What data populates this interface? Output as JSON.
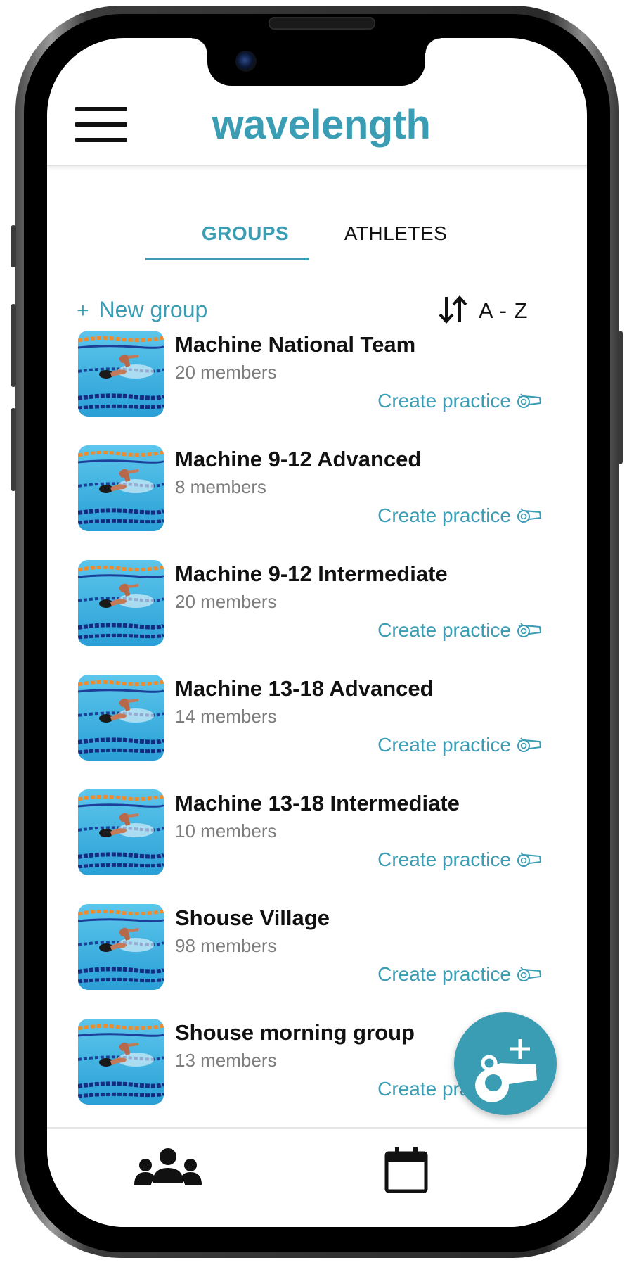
{
  "header": {
    "app_title": "wavelength",
    "menu_icon": "hamburger-menu-icon"
  },
  "tabs": [
    {
      "label": "GROUPS",
      "active": true
    },
    {
      "label": "ATHLETES",
      "active": false
    }
  ],
  "actions": {
    "new_group_plus": "+",
    "new_group_label": "New group",
    "sort_icon": "sort-arrows-icon",
    "sort_label": "A - Z"
  },
  "groups": [
    {
      "name": "Machine National Team",
      "members": "20 members",
      "action": "Create practice"
    },
    {
      "name": "Machine 9-12 Advanced",
      "members": "8 members",
      "action": "Create practice"
    },
    {
      "name": "Machine 9-12 Intermediate",
      "members": "20 members",
      "action": "Create practice"
    },
    {
      "name": "Machine 13-18 Advanced",
      "members": "14 members",
      "action": "Create practice"
    },
    {
      "name": "Machine 13-18 Intermediate",
      "members": "10 members",
      "action": "Create practice"
    },
    {
      "name": "Shouse Village",
      "members": "98 members",
      "action": "Create practice"
    },
    {
      "name": "Shouse morning group",
      "members": "13 members",
      "action": "Create practice"
    }
  ],
  "fab": {
    "icon": "whistle-plus-icon"
  },
  "bottom_nav": [
    {
      "icon": "people-group-icon"
    },
    {
      "icon": "calendar-icon"
    }
  ],
  "colors": {
    "accent": "#3a9db3",
    "text": "#111111",
    "muted": "#7d7d7d"
  }
}
